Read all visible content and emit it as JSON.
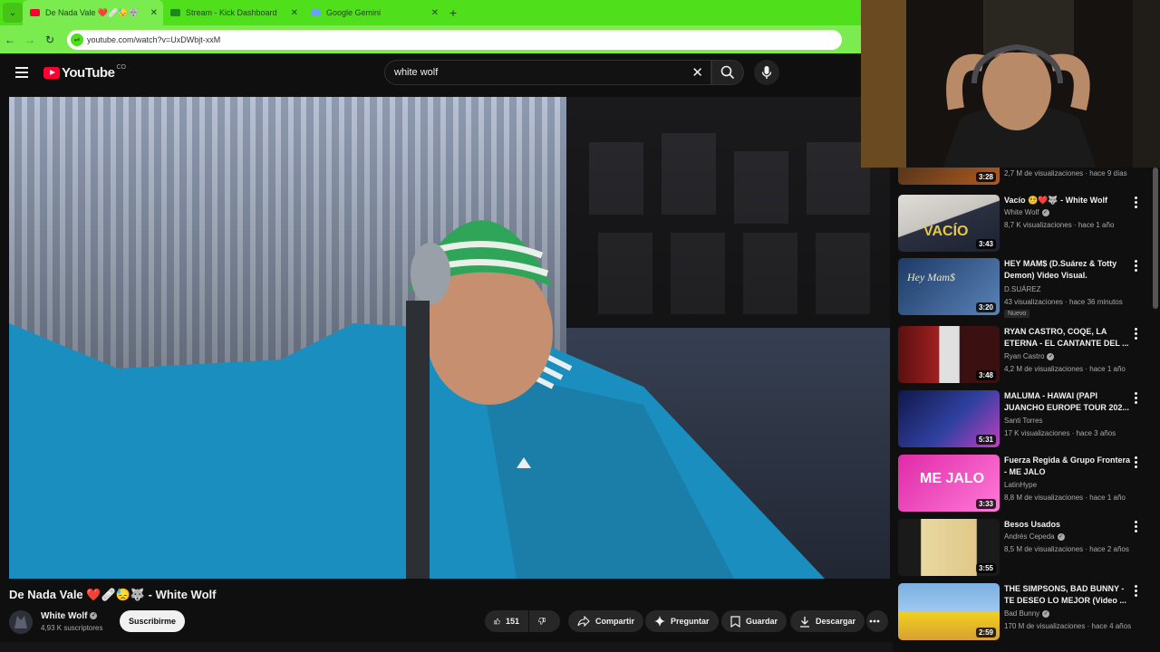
{
  "browser": {
    "tabs": [
      {
        "label": "De Nada Vale ❤️🩹😓🐺",
        "fav_color": "#ff0033",
        "active": true
      },
      {
        "label": "Stream - Kick Dashboard",
        "fav_color": "#1b8a1b",
        "active": false
      },
      {
        "label": "Google Gemini",
        "fav_color": "#6aa0ff",
        "active": false
      }
    ],
    "url": "youtube.com/watch?v=UxDWbjt-xxM"
  },
  "header": {
    "logo": "YouTube",
    "country": "CO",
    "search_query": "white wolf"
  },
  "video": {
    "title": "De Nada Vale ❤️🩹😓🐺 - White Wolf",
    "channel": "White Wolf",
    "subscribers": "4,93 K suscriptores",
    "subscribe_label": "Suscribirme",
    "likes": "151",
    "share_label": "Compartir",
    "ask_label": "Preguntar",
    "save_label": "Guardar",
    "download_label": "Descargar"
  },
  "recommendations": [
    {
      "title": "",
      "channel": "",
      "meta": "2,7 M de visualizaciones · hace 9 días",
      "duration": "3:28",
      "verified": false,
      "colors": [
        "#3a2a1a",
        "#b05a20"
      ]
    },
    {
      "title": "Vacío 😵‍💫❤️🐺 - White Wolf",
      "channel": "White Wolf",
      "meta": "8,7 K visualizaciones · hace 1 año",
      "duration": "3:43",
      "verified": true,
      "colors": [
        "#c8c4bf",
        "#2a3040"
      ],
      "thumb_text": "VACÍO"
    },
    {
      "title": "HEY MAM$ (D.Suárez & Totty Demon) Video Visual.",
      "channel": "D.SUÁREZ",
      "meta": "43 visualizaciones · hace 36 minutos",
      "duration": "3:20",
      "verified": false,
      "badge": "Nuevo",
      "colors": [
        "#1c3a66",
        "#5a83b8"
      ],
      "thumb_text": "Hey Mam$"
    },
    {
      "title": "RYAN CASTRO, COQE, LA ETERNA - EL CANTANTE DEL ...",
      "channel": "Ryan Castro",
      "meta": "4,2 M de visualizaciones · hace 1 año",
      "duration": "3:48",
      "verified": true,
      "colors": [
        "#5a1010",
        "#e0e0e0"
      ]
    },
    {
      "title": "MALUMA - HAWAI (PAPI JUANCHO EUROPE TOUR 202...",
      "channel": "Santi Torres",
      "meta": "17 K visualizaciones · hace 3 años",
      "duration": "5:31",
      "verified": false,
      "colors": [
        "#10184a",
        "#c040c0"
      ]
    },
    {
      "title": "Fuerza Regida & Grupo Frontera - ME JALO",
      "channel": "LatinHype",
      "meta": "8,8 M de visualizaciones · hace 1 año",
      "duration": "3:33",
      "verified": false,
      "colors": [
        "#e02aa8",
        "#ff7ad8"
      ],
      "thumb_text": "ME JALO"
    },
    {
      "title": "Besos Usados",
      "channel": "Andrés Cepeda",
      "meta": "8,5 M de visualizaciones · hace 2 años",
      "duration": "3:55",
      "verified": true,
      "colors": [
        "#e8d8a0",
        "#3a4a8a"
      ]
    },
    {
      "title": "THE SIMPSONS, BAD BUNNY - TE DESEO LO MEJOR (Video ...",
      "channel": "Bad Bunny",
      "meta": "170 M de visualizaciones · hace 4 años",
      "duration": "2:59",
      "verified": true,
      "colors": [
        "#7ab0e0",
        "#f0d020"
      ]
    }
  ]
}
